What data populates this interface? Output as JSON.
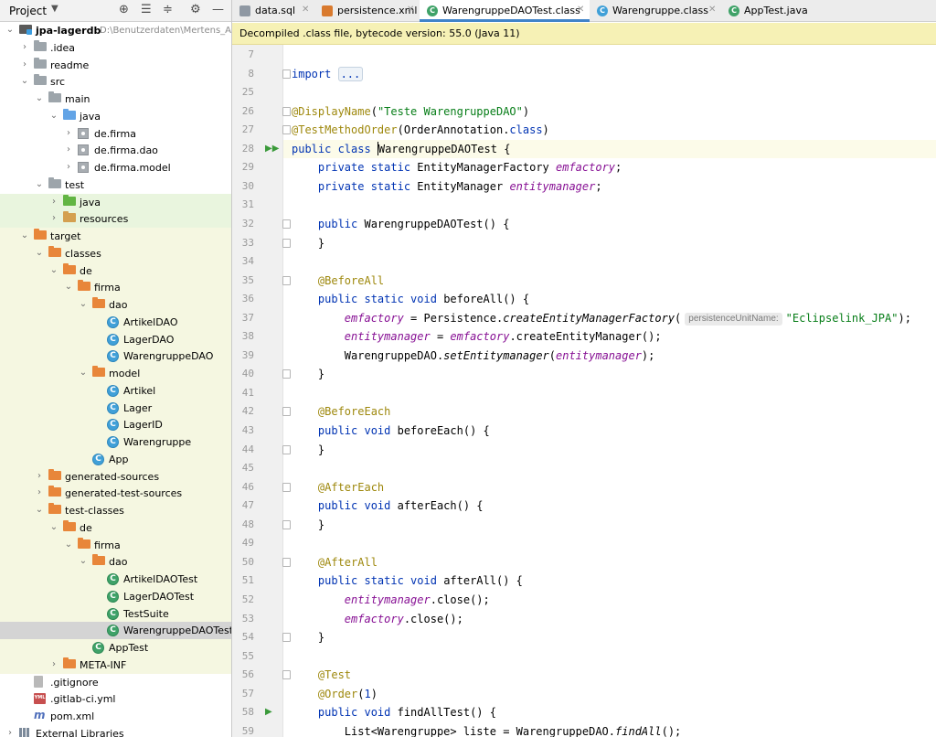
{
  "project_panel": {
    "title": "Project",
    "items": [
      {
        "label": "jpa-lagerdb",
        "path": "D:\\Benutzerdaten\\Mertens_Achim",
        "icon": "module-folder-icon",
        "depth": 0,
        "expanded": true,
        "bold": true
      },
      {
        "label": ".idea",
        "icon": "folder-icon",
        "depth": 1,
        "expanded": false
      },
      {
        "label": "readme",
        "icon": "folder-icon",
        "depth": 1,
        "expanded": false
      },
      {
        "label": "src",
        "icon": "folder-icon",
        "depth": 1,
        "expanded": true
      },
      {
        "label": "main",
        "icon": "folder-icon",
        "depth": 2,
        "expanded": true
      },
      {
        "label": "java",
        "icon": "source-folder-icon",
        "depth": 3,
        "expanded": true
      },
      {
        "label": "de.firma",
        "icon": "package-icon",
        "depth": 4,
        "expanded": false
      },
      {
        "label": "de.firma.dao",
        "icon": "package-icon",
        "depth": 4,
        "expanded": false
      },
      {
        "label": "de.firma.model",
        "icon": "package-icon",
        "depth": 4,
        "expanded": false
      },
      {
        "label": "test",
        "icon": "folder-icon",
        "depth": 2,
        "expanded": true
      },
      {
        "label": "java",
        "icon": "test-source-folder-icon",
        "depth": 3,
        "expanded": false,
        "row_style": "test"
      },
      {
        "label": "resources",
        "icon": "test-resources-folder-icon",
        "depth": 3,
        "expanded": false,
        "row_style": "test"
      },
      {
        "label": "target",
        "icon": "excluded-folder-icon",
        "depth": 1,
        "expanded": true,
        "row_style": "highlight"
      },
      {
        "label": "classes",
        "icon": "excluded-folder-icon",
        "depth": 2,
        "expanded": true,
        "row_style": "highlight"
      },
      {
        "label": "de",
        "icon": "excluded-folder-icon",
        "depth": 3,
        "expanded": true,
        "row_style": "highlight"
      },
      {
        "label": "firma",
        "icon": "excluded-folder-icon",
        "depth": 4,
        "expanded": true,
        "row_style": "highlight"
      },
      {
        "label": "dao",
        "icon": "excluded-folder-icon",
        "depth": 5,
        "expanded": true,
        "row_style": "highlight"
      },
      {
        "label": "ArtikelDAO",
        "icon": "class-icon",
        "depth": 6,
        "row_style": "highlight"
      },
      {
        "label": "LagerDAO",
        "icon": "class-icon",
        "depth": 6,
        "row_style": "highlight"
      },
      {
        "label": "WarengruppeDAO",
        "icon": "class-icon",
        "depth": 6,
        "row_style": "highlight"
      },
      {
        "label": "model",
        "icon": "excluded-folder-icon",
        "depth": 5,
        "expanded": true,
        "row_style": "highlight"
      },
      {
        "label": "Artikel",
        "icon": "class-icon",
        "depth": 6,
        "row_style": "highlight"
      },
      {
        "label": "Lager",
        "icon": "class-icon",
        "depth": 6,
        "row_style": "highlight"
      },
      {
        "label": "LagerID",
        "icon": "class-icon",
        "depth": 6,
        "row_style": "highlight"
      },
      {
        "label": "Warengruppe",
        "icon": "class-icon",
        "depth": 6,
        "row_style": "highlight"
      },
      {
        "label": "App",
        "icon": "class-icon",
        "depth": 5,
        "row_style": "highlight"
      },
      {
        "label": "generated-sources",
        "icon": "excluded-folder-icon",
        "depth": 2,
        "expanded": false,
        "row_style": "highlight"
      },
      {
        "label": "generated-test-sources",
        "icon": "excluded-folder-icon",
        "depth": 2,
        "expanded": false,
        "row_style": "highlight"
      },
      {
        "label": "test-classes",
        "icon": "excluded-folder-icon",
        "depth": 2,
        "expanded": true,
        "row_style": "highlight"
      },
      {
        "label": "de",
        "icon": "excluded-folder-icon",
        "depth": 3,
        "expanded": true,
        "row_style": "highlight"
      },
      {
        "label": "firma",
        "icon": "excluded-folder-icon",
        "depth": 4,
        "expanded": true,
        "row_style": "highlight"
      },
      {
        "label": "dao",
        "icon": "excluded-folder-icon",
        "depth": 5,
        "expanded": true,
        "row_style": "highlight"
      },
      {
        "label": "ArtikelDAOTest",
        "icon": "test-class-icon",
        "depth": 6,
        "row_style": "highlight"
      },
      {
        "label": "LagerDAOTest",
        "icon": "test-class-icon",
        "depth": 6,
        "row_style": "highlight"
      },
      {
        "label": "TestSuite",
        "icon": "test-class-icon",
        "depth": 6,
        "row_style": "highlight"
      },
      {
        "label": "WarengruppeDAOTest",
        "icon": "test-class-icon",
        "depth": 6,
        "row_style": "selected"
      },
      {
        "label": "AppTest",
        "icon": "test-class-icon",
        "depth": 5,
        "row_style": "highlight"
      },
      {
        "label": "META-INF",
        "icon": "excluded-folder-icon",
        "depth": 3,
        "expanded": false,
        "row_style": "highlight"
      },
      {
        "label": ".gitignore",
        "icon": "gitignore-file-icon",
        "depth": 1
      },
      {
        "label": ".gitlab-ci.yml",
        "icon": "yml-file-icon",
        "depth": 1
      },
      {
        "label": "pom.xml",
        "icon": "maven-pom-icon",
        "depth": 1
      },
      {
        "label": "External Libraries",
        "icon": "library-icon",
        "depth": 0,
        "expanded": false
      }
    ]
  },
  "tabs": [
    {
      "label": "data.sql",
      "icon": "sql-file-icon",
      "active": false
    },
    {
      "label": "persistence.xml",
      "icon": "xml-file-icon",
      "active": false
    },
    {
      "label": "WarengruppeDAOTest.class",
      "icon": "test-class-icon",
      "active": true
    },
    {
      "label": "Warengruppe.class",
      "icon": "class-icon",
      "active": false
    },
    {
      "label": "AppTest.java",
      "icon": "test-class-icon",
      "active": false
    }
  ],
  "banner": "Decompiled .class file, bytecode version: 55.0 (Java 11)",
  "code_lines": [
    {
      "n": "7",
      "segs": []
    },
    {
      "n": "8",
      "fold": true,
      "segs": [
        {
          "t": "import ",
          "c": "kw"
        },
        {
          "t": "...",
          "c": "fo"
        }
      ]
    },
    {
      "n": "25",
      "segs": []
    },
    {
      "n": "26",
      "fold": true,
      "segs": [
        {
          "t": "@DisplayName",
          "c": "an"
        },
        {
          "t": "("
        },
        {
          "t": "\"Teste WarengruppeDAO\"",
          "c": "str"
        },
        {
          "t": ")"
        }
      ]
    },
    {
      "n": "27",
      "fold": true,
      "segs": [
        {
          "t": "@TestMethodOrder",
          "c": "an"
        },
        {
          "t": "(OrderAnnotation."
        },
        {
          "t": "class",
          "c": "kw"
        },
        {
          "t": ")"
        }
      ]
    },
    {
      "n": "28",
      "run": "double",
      "cur": true,
      "segs": [
        {
          "t": "public class ",
          "c": "kw"
        },
        {
          "t": "",
          "c": "caret"
        },
        {
          "t": "WarengruppeDAOTest {"
        }
      ]
    },
    {
      "n": "29",
      "segs": [
        {
          "t": "    "
        },
        {
          "t": "private static ",
          "c": "kw"
        },
        {
          "t": "EntityManagerFactory "
        },
        {
          "t": "emfactory",
          "c": "fi"
        },
        {
          "t": ";"
        }
      ]
    },
    {
      "n": "30",
      "segs": [
        {
          "t": "    "
        },
        {
          "t": "private static ",
          "c": "kw"
        },
        {
          "t": "EntityManager "
        },
        {
          "t": "entitymanager",
          "c": "fi"
        },
        {
          "t": ";"
        }
      ]
    },
    {
      "n": "31",
      "segs": []
    },
    {
      "n": "32",
      "fold": true,
      "segs": [
        {
          "t": "    "
        },
        {
          "t": "public ",
          "c": "kw"
        },
        {
          "t": "WarengruppeDAOTest() {"
        }
      ]
    },
    {
      "n": "33",
      "fold": true,
      "segs": [
        {
          "t": "    }"
        }
      ]
    },
    {
      "n": "34",
      "segs": []
    },
    {
      "n": "35",
      "fold": true,
      "segs": [
        {
          "t": "    "
        },
        {
          "t": "@BeforeAll",
          "c": "an"
        }
      ]
    },
    {
      "n": "36",
      "segs": [
        {
          "t": "    "
        },
        {
          "t": "public static void ",
          "c": "kw"
        },
        {
          "t": "beforeAll() {"
        }
      ]
    },
    {
      "n": "37",
      "segs": [
        {
          "t": "        "
        },
        {
          "t": "emfactory",
          "c": "fi"
        },
        {
          "t": " = Persistence."
        },
        {
          "t": "createEntityManagerFactory",
          "c": "st"
        },
        {
          "t": "("
        },
        {
          "t": "persistenceUnitName:",
          "c": "hint"
        },
        {
          "t": "\"Eclipselink_JPA\"",
          "c": "str"
        },
        {
          "t": ");"
        }
      ]
    },
    {
      "n": "38",
      "segs": [
        {
          "t": "        "
        },
        {
          "t": "entitymanager",
          "c": "fi"
        },
        {
          "t": " = "
        },
        {
          "t": "emfactory",
          "c": "fi"
        },
        {
          "t": ".createEntityManager();"
        }
      ]
    },
    {
      "n": "39",
      "segs": [
        {
          "t": "        WarengruppeDAO."
        },
        {
          "t": "setEntitymanager",
          "c": "st"
        },
        {
          "t": "("
        },
        {
          "t": "entitymanager",
          "c": "fi"
        },
        {
          "t": ");"
        }
      ]
    },
    {
      "n": "40",
      "fold": true,
      "segs": [
        {
          "t": "    }"
        }
      ]
    },
    {
      "n": "41",
      "segs": []
    },
    {
      "n": "42",
      "fold": true,
      "segs": [
        {
          "t": "    "
        },
        {
          "t": "@BeforeEach",
          "c": "an"
        }
      ]
    },
    {
      "n": "43",
      "segs": [
        {
          "t": "    "
        },
        {
          "t": "public void ",
          "c": "kw"
        },
        {
          "t": "beforeEach() {"
        }
      ]
    },
    {
      "n": "44",
      "fold": true,
      "segs": [
        {
          "t": "    }"
        }
      ]
    },
    {
      "n": "45",
      "segs": []
    },
    {
      "n": "46",
      "fold": true,
      "segs": [
        {
          "t": "    "
        },
        {
          "t": "@AfterEach",
          "c": "an"
        }
      ]
    },
    {
      "n": "47",
      "segs": [
        {
          "t": "    "
        },
        {
          "t": "public void ",
          "c": "kw"
        },
        {
          "t": "afterEach() {"
        }
      ]
    },
    {
      "n": "48",
      "fold": true,
      "segs": [
        {
          "t": "    }"
        }
      ]
    },
    {
      "n": "49",
      "segs": []
    },
    {
      "n": "50",
      "fold": true,
      "segs": [
        {
          "t": "    "
        },
        {
          "t": "@AfterAll",
          "c": "an"
        }
      ]
    },
    {
      "n": "51",
      "segs": [
        {
          "t": "    "
        },
        {
          "t": "public static void ",
          "c": "kw"
        },
        {
          "t": "afterAll() {"
        }
      ]
    },
    {
      "n": "52",
      "segs": [
        {
          "t": "        "
        },
        {
          "t": "entitymanager",
          "c": "fi"
        },
        {
          "t": ".close();"
        }
      ]
    },
    {
      "n": "53",
      "segs": [
        {
          "t": "        "
        },
        {
          "t": "emfactory",
          "c": "fi"
        },
        {
          "t": ".close();"
        }
      ]
    },
    {
      "n": "54",
      "fold": true,
      "segs": [
        {
          "t": "    }"
        }
      ]
    },
    {
      "n": "55",
      "segs": []
    },
    {
      "n": "56",
      "fold": true,
      "segs": [
        {
          "t": "    "
        },
        {
          "t": "@Test",
          "c": "an"
        }
      ]
    },
    {
      "n": "57",
      "segs": [
        {
          "t": "    "
        },
        {
          "t": "@Order",
          "c": "an"
        },
        {
          "t": "("
        },
        {
          "t": "1",
          "c": "kw"
        },
        {
          "t": ")"
        }
      ]
    },
    {
      "n": "58",
      "run": "single",
      "segs": [
        {
          "t": "    "
        },
        {
          "t": "public void ",
          "c": "kw"
        },
        {
          "t": "findAllTest() {"
        }
      ]
    },
    {
      "n": "59",
      "segs": [
        {
          "t": "        List<Warengruppe> liste = WarengruppeDAO."
        },
        {
          "t": "findAll",
          "c": "st"
        },
        {
          "t": "();"
        }
      ]
    }
  ],
  "colors": {
    "keyword": "#0033b3",
    "annotation": "#9e880d",
    "string": "#067d17",
    "field": "#871094",
    "banner": "#f6f1b5",
    "excluded_row": "#f5f7e1",
    "selected_row": "#d4d4d4",
    "active_tab_underline": "#4083c9"
  }
}
